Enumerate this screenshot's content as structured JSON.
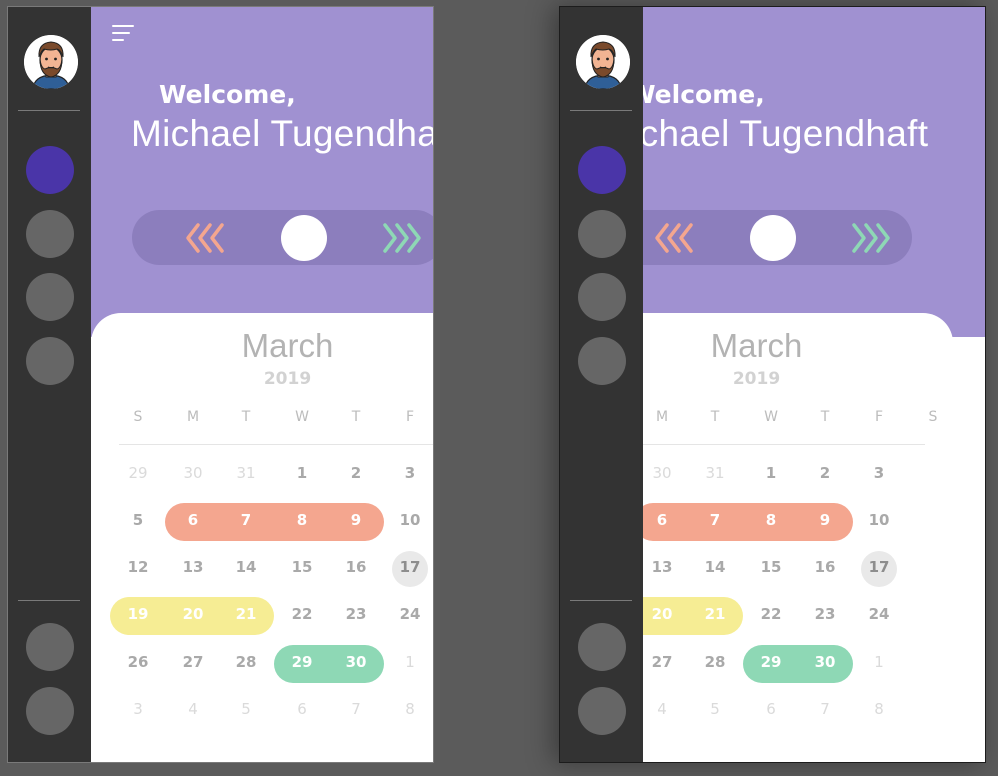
{
  "greeting": "Welcome,",
  "user": {
    "name": "Michael Tugendhaft"
  },
  "calendar": {
    "month": "March",
    "year": "2019",
    "weekdays": [
      "S",
      "M",
      "T",
      "W",
      "T",
      "F",
      "S"
    ],
    "weeks": [
      [
        "29",
        "30",
        "31",
        "1",
        "2",
        "3",
        ""
      ],
      [
        "5",
        "6",
        "7",
        "8",
        "9",
        "10",
        ""
      ],
      [
        "12",
        "13",
        "14",
        "15",
        "16",
        "17",
        ""
      ],
      [
        "19",
        "20",
        "21",
        "22",
        "23",
        "24",
        ""
      ],
      [
        "26",
        "27",
        "28",
        "29",
        "30",
        "1",
        ""
      ],
      [
        "3",
        "4",
        "5",
        "6",
        "7",
        "8",
        ""
      ]
    ],
    "today": "17",
    "highlight_colors": {
      "salmon": "#f4a68f",
      "yellow": "#f6ed94",
      "mint": "#8ed8b5",
      "today": "#e9e9e9"
    }
  },
  "theme": {
    "header": "#a091d1",
    "sidebar": "#333333",
    "sidebar_active": "#4a35a8",
    "sidebar_inactive": "#666666"
  },
  "icons": {
    "menu": "menu-icon",
    "back_arrows": "chevrons-left-icon",
    "forward_arrows": "chevrons-right-icon",
    "avatar": "bearded-man-avatar"
  }
}
